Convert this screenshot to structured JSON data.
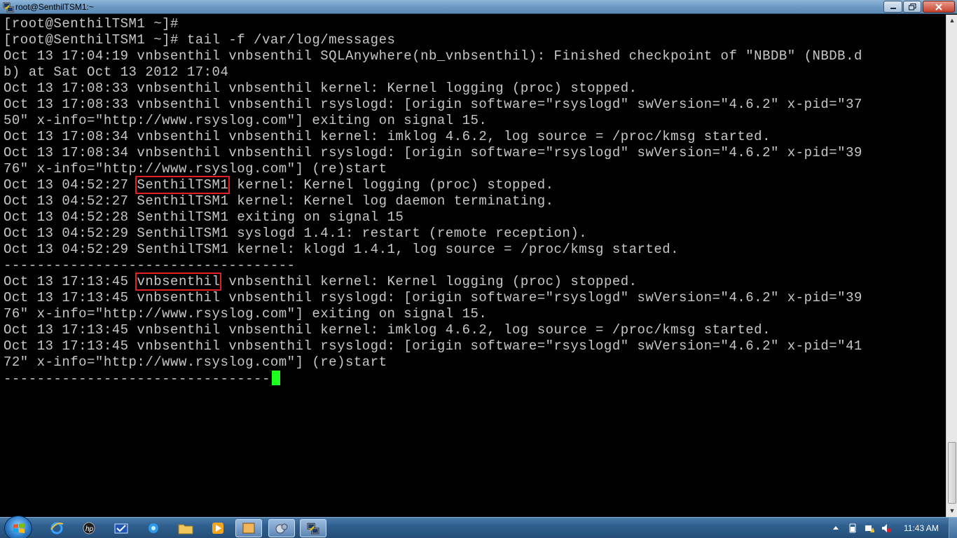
{
  "window": {
    "title": "root@SenthilTSM1:~"
  },
  "terminal": {
    "lines": [
      "[root@SenthilTSM1 ~]#",
      "[root@SenthilTSM1 ~]# tail -f /var/log/messages",
      "Oct 13 17:04:19 vnbsenthil vnbsenthil SQLAnywhere(nb_vnbsenthil): Finished checkpoint of \"NBDB\" (NBDB.d",
      "b) at Sat Oct 13 2012 17:04",
      "Oct 13 17:08:33 vnbsenthil vnbsenthil kernel: Kernel logging (proc) stopped.",
      "Oct 13 17:08:33 vnbsenthil vnbsenthil rsyslogd: [origin software=\"rsyslogd\" swVersion=\"4.6.2\" x-pid=\"37",
      "50\" x-info=\"http://www.rsyslog.com\"] exiting on signal 15.",
      "Oct 13 17:08:34 vnbsenthil vnbsenthil kernel: imklog 4.6.2, log source = /proc/kmsg started.",
      "Oct 13 17:08:34 vnbsenthil vnbsenthil rsyslogd: [origin software=\"rsyslogd\" swVersion=\"4.6.2\" x-pid=\"39",
      "76\" x-info=\"http://www.rsyslog.com\"] (re)start",
      {
        "pre": "Oct 13 04:52:27 ",
        "hl": "SenthilTSM1",
        "post": " kernel: Kernel logging (proc) stopped."
      },
      "Oct 13 04:52:27 SenthilTSM1 kernel: Kernel log daemon terminating.",
      "Oct 13 04:52:28 SenthilTSM1 exiting on signal 15",
      "Oct 13 04:52:29 SenthilTSM1 syslogd 1.4.1: restart (remote reception).",
      "Oct 13 04:52:29 SenthilTSM1 kernel: klogd 1.4.1, log source = /proc/kmsg started.",
      "-----------------------------------",
      {
        "pre": "Oct 13 17:13:45 ",
        "hl": "vnbsenthil",
        "post": " vnbsenthil kernel: Kernel logging (proc) stopped."
      },
      "Oct 13 17:13:45 vnbsenthil vnbsenthil rsyslogd: [origin software=\"rsyslogd\" swVersion=\"4.6.2\" x-pid=\"39",
      "76\" x-info=\"http://www.rsyslog.com\"] exiting on signal 15.",
      "Oct 13 17:13:45 vnbsenthil vnbsenthil kernel: imklog 4.6.2, log source = /proc/kmsg started.",
      "Oct 13 17:13:45 vnbsenthil vnbsenthil rsyslogd: [origin software=\"rsyslogd\" swVersion=\"4.6.2\" x-pid=\"41",
      "72\" x-info=\"http://www.rsyslog.com\"] (re)start",
      {
        "pre": "--------------------------------",
        "cursor": true
      }
    ],
    "highlight_color": "#e02020",
    "cursor_color": "#1eff1e"
  },
  "taskbar": {
    "pinned": [
      {
        "name": "internet-explorer-icon"
      },
      {
        "name": "hp-icon"
      },
      {
        "name": "outlook-icon"
      },
      {
        "name": "messenger-icon"
      },
      {
        "name": "windows-explorer-icon"
      },
      {
        "name": "media-player-icon"
      },
      {
        "name": "folder-window-icon"
      },
      {
        "name": "network-tool-icon"
      },
      {
        "name": "putty-icon"
      }
    ],
    "clock": "11:43 AM"
  }
}
